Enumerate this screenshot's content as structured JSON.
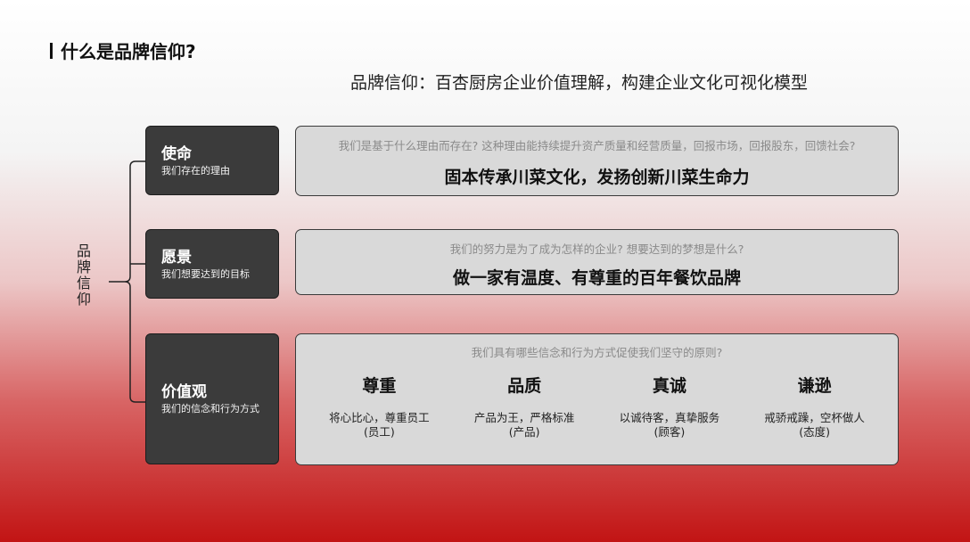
{
  "title": "什么是品牌信仰?",
  "subtitle": "品牌信仰：百杏厨房企业价值理解，构建企业文化可视化模型",
  "side_label": [
    "品",
    "牌",
    "信",
    "仰"
  ],
  "rows": [
    {
      "heading": "使命",
      "sub": "我们存在的理由",
      "question": "我们是基于什么理由而存在? 这种理由能持续提升资产质量和经营质量，回报市场，回报股东，回馈社会?",
      "answer": "固本传承川菜文化，发扬创新川菜生命力"
    },
    {
      "heading": "愿景",
      "sub": "我们想要达到的目标",
      "question": "我们的努力是为了成为怎样的企业? 想要达到的梦想是什么?",
      "answer": "做一家有温度、有尊重的百年餐饮品牌"
    },
    {
      "heading": "价值观",
      "sub": "我们的信念和行为方式",
      "question": "我们具有哪些信念和行为方式促使我们坚守的原则?"
    }
  ],
  "values": [
    {
      "title": "尊重",
      "line1": "将心比心，尊重员工",
      "line2": "(员工)"
    },
    {
      "title": "品质",
      "line1": "产品为王，严格标准",
      "line2": "(产品)"
    },
    {
      "title": "真诚",
      "line1": "以诚待客，真挚服务",
      "line2": "(顾客)"
    },
    {
      "title": "谦逊",
      "line1": "戒骄戒躁，空杯做人",
      "line2": "(态度)"
    }
  ]
}
